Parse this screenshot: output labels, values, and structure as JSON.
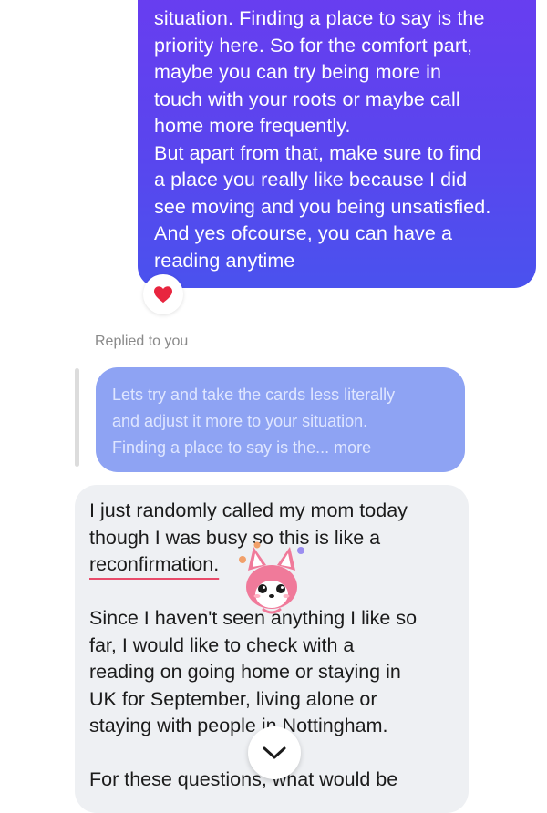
{
  "sent_message": {
    "line1": "situation. Finding a place to say is the",
    "line2": "priority here. So for the comfort part,",
    "line3": "maybe you can try being more in",
    "line4": "touch with your roots or maybe call",
    "line5": "home more frequently.",
    "line6": "But apart from that, make sure to find",
    "line7": "a place you really like because I did",
    "line8": "see moving and you being unsatisfied.",
    "line9": "And yes ofcourse, you can have a",
    "line10": "reading anytime"
  },
  "reaction": {
    "icon": "heart-icon",
    "color": "#e8253f"
  },
  "reply_label": "Replied to you",
  "quoted_message": {
    "line1": "Lets try and take the cards less literally",
    "line2": "and adjust it more to your situation.",
    "line3": "Finding a place to say is the... more"
  },
  "received_message": {
    "line1": "I just randomly called my mom today",
    "line2": "though I was busy so this is like a",
    "line3": "reconfirmation.",
    "line4": "Since I haven't seen anything I like so",
    "line5": "far, I would like to check with a",
    "line6": "reading on going home or staying in",
    "line7": "UK for September, living alone or",
    "line8": "staying with people in Nottingham.",
    "line9": "For these questions, what would be"
  },
  "scroll_button": {
    "icon": "chevron-down-icon"
  },
  "sticker": {
    "icon": "fox-sticker-icon"
  },
  "colors": {
    "sent_bubble": "#5a45ee",
    "quoted_bubble": "#8ea3f3",
    "received_bubble": "#eef0f3",
    "underline": "#e84b6a"
  }
}
